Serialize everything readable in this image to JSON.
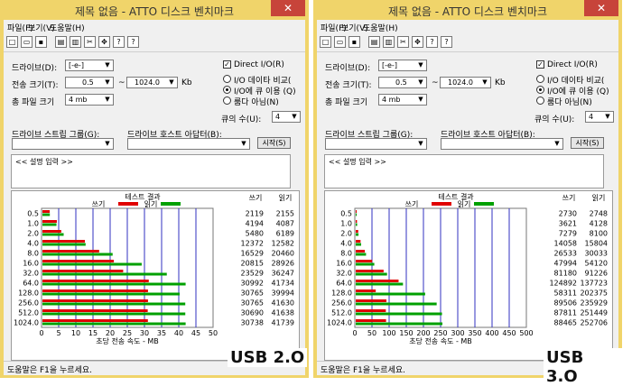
{
  "windows": [
    {
      "id": "usb2",
      "title": "제목 없음 - ATTO 디스크 벤치마크",
      "menu": [
        "파일(F)",
        "보기(V)",
        "도움말(H)"
      ],
      "close_glyph": "✕",
      "drive_label": "드라이브(D):",
      "drive_value": "[-e-]",
      "transfer_label": "전송 크기(T):",
      "transfer_from": "0.5",
      "transfer_to": "1024.0",
      "transfer_sep": "~",
      "transfer_unit": "Kb",
      "total_label": "총 파일 크기",
      "total_value": "4 mb",
      "direct_io": "Direct I/O(R)",
      "direct_io_checked": true,
      "radio_1": "I/O 데이타 비교(",
      "radio_2": "I/O에 큐 이용 (Q)",
      "radio_3": "룸다 아님(N)",
      "queue_label": "큐의 수(U):",
      "queue_value": "4",
      "stream_label": "드라이브 스트립 그룹(G):",
      "adapter_label": "드라이브 호스트 아답터(B):",
      "start_button": "시작(S)",
      "description": "<< 설명 입력 >>",
      "results_title": "테스트 결과",
      "legend_write": "쓰기",
      "legend_read": "읽기",
      "col_write": "쓰기",
      "col_read": "읽기",
      "axis_label": "초당 전송 속도 - MB",
      "status": "도움말은 F1을 누르세요.",
      "badge": "USB 2.O",
      "chart_data": {
        "type": "bar",
        "title": "테스트 결과",
        "xlabel": "초당 전송 속도 - MB",
        "categories": [
          "0.5",
          "1.0",
          "2.0",
          "4.0",
          "8.0",
          "16.0",
          "32.0",
          "64.0",
          "128.0",
          "256.0",
          "512.0",
          "1024.0"
        ],
        "series": [
          {
            "name": "쓰기",
            "color": "#e00000",
            "values": [
              2119,
              4194,
              5480,
              12372,
              16529,
              20815,
              23529,
              30992,
              30765,
              30765,
              30690,
              30738
            ]
          },
          {
            "name": "읽기",
            "color": "#00a000",
            "values": [
              2155,
              4087,
              6189,
              12582,
              20460,
              28926,
              36247,
              41734,
              39994,
              41630,
              41638,
              41739
            ]
          }
        ],
        "xlim": [
          0,
          50
        ],
        "ticks": [
          "0",
          "5",
          "10",
          "15",
          "20",
          "25",
          "30",
          "35",
          "40",
          "45",
          "50"
        ],
        "grid": true,
        "legend": "top"
      }
    },
    {
      "id": "usb3",
      "title": "제목 없음 - ATTO 디스크 벤치마크",
      "menu": [
        "파일(F)",
        "보기(V)",
        "도움말(H)"
      ],
      "close_glyph": "✕",
      "drive_label": "드라이브(D):",
      "drive_value": "[-e-]",
      "transfer_label": "전송 크기(T):",
      "transfer_from": "0.5",
      "transfer_to": "1024.0",
      "transfer_sep": "~",
      "transfer_unit": "Kb",
      "total_label": "총 파일 크기",
      "total_value": "4 mb",
      "direct_io": "Direct I/O(R)",
      "direct_io_checked": true,
      "radio_1": "I/O 데이타 비교(",
      "radio_2": "I/O에 큐 이용 (Q)",
      "radio_3": "룸다 아님(N)",
      "queue_label": "큐의 수(U):",
      "queue_value": "4",
      "stream_label": "드라이브 스트립 그룹(G):",
      "adapter_label": "드라이브 호스트 아답터(B):",
      "start_button": "시작(S)",
      "description": "<< 설명 입력 >>",
      "results_title": "테스트 결과",
      "legend_write": "쓰기",
      "legend_read": "읽기",
      "col_write": "쓰기",
      "col_read": "읽기",
      "axis_label": "초당 전송 속도 - MB",
      "status": "도움말은 F1을 누르세요.",
      "badge": "USB 3.O",
      "chart_data": {
        "type": "bar",
        "title": "테스트 결과",
        "xlabel": "초당 전송 속도 - MB",
        "categories": [
          "0.5",
          "1.0",
          "2.0",
          "4.0",
          "8.0",
          "16.0",
          "32.0",
          "64.0",
          "128.0",
          "256.0",
          "512.0",
          "1024.0"
        ],
        "series": [
          {
            "name": "쓰기",
            "color": "#e00000",
            "values": [
              2730,
              3621,
              7279,
              14058,
              26533,
              47994,
              81180,
              124892,
              58311,
              89506,
              87811,
              88465
            ]
          },
          {
            "name": "읽기",
            "color": "#00a000",
            "values": [
              2748,
              4128,
              8100,
              15804,
              30033,
              54120,
              91226,
              137723,
              202375,
              235929,
              251449,
              252706
            ]
          }
        ],
        "xlim": [
          0,
          500
        ],
        "ticks": [
          "0",
          "50",
          "100",
          "150",
          "200",
          "250",
          "300",
          "350",
          "400",
          "450",
          "500"
        ],
        "grid": true,
        "legend": "top"
      }
    }
  ]
}
